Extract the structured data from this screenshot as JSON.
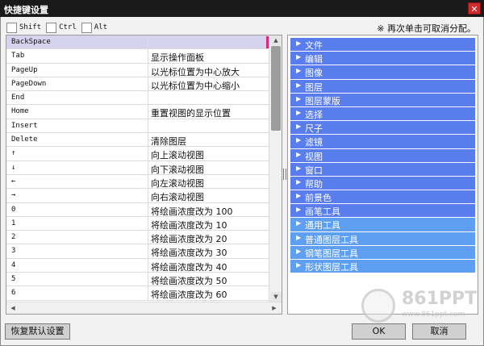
{
  "window": {
    "title": "快捷键设置",
    "close_glyph": "✕"
  },
  "modifiers": [
    {
      "label": "Shift",
      "checked": false
    },
    {
      "label": "Ctrl",
      "checked": false
    },
    {
      "label": "Alt",
      "checked": false
    }
  ],
  "hint": "※ 再次单击可取消分配。",
  "shortcuts": [
    {
      "key": "BackSpace",
      "action": "",
      "selected": true
    },
    {
      "key": "Tab",
      "action": "显示操作面板"
    },
    {
      "key": "PageUp",
      "action": "以光标位置为中心放大"
    },
    {
      "key": "PageDown",
      "action": "以光标位置为中心缩小"
    },
    {
      "key": "End",
      "action": ""
    },
    {
      "key": "Home",
      "action": "重置视图的显示位置"
    },
    {
      "key": "Insert",
      "action": ""
    },
    {
      "key": "Delete",
      "action": "清除图层"
    },
    {
      "key": "↑",
      "action": "向上滚动视图"
    },
    {
      "key": "↓",
      "action": "向下滚动视图"
    },
    {
      "key": "←",
      "action": "向左滚动视图"
    },
    {
      "key": "→",
      "action": "向右滚动视图"
    },
    {
      "key": "0",
      "action": "将绘画浓度改为 100"
    },
    {
      "key": "1",
      "action": "将绘画浓度改为 10"
    },
    {
      "key": "2",
      "action": "将绘画浓度改为 20"
    },
    {
      "key": "3",
      "action": "将绘画浓度改为 30"
    },
    {
      "key": "4",
      "action": "将绘画浓度改为 40"
    },
    {
      "key": "5",
      "action": "将绘画浓度改为 50"
    },
    {
      "key": "6",
      "action": "将绘画浓度改为 60"
    }
  ],
  "scroll_glyphs": {
    "up": "▲",
    "down": "▼",
    "left": "◀",
    "right": "▶"
  },
  "menu_arrow": "▶",
  "menu_groups": [
    {
      "label": "文件",
      "style": "dark"
    },
    {
      "label": "编辑",
      "style": "dark"
    },
    {
      "label": "图像",
      "style": "dark"
    },
    {
      "label": "图层",
      "style": "dark"
    },
    {
      "label": "图层蒙版",
      "style": "dark"
    },
    {
      "label": "选择",
      "style": "dark"
    },
    {
      "label": "尺子",
      "style": "dark"
    },
    {
      "label": "滤镜",
      "style": "dark"
    },
    {
      "label": "视图",
      "style": "dark"
    },
    {
      "label": "窗口",
      "style": "dark"
    },
    {
      "label": "帮助",
      "style": "dark"
    },
    {
      "label": "前景色",
      "style": "dark"
    },
    {
      "label": "画笔工具",
      "style": "dark"
    },
    {
      "label": "通用工具",
      "style": "light"
    },
    {
      "label": "普通图层工具",
      "style": "light"
    },
    {
      "label": "钢笔图层工具",
      "style": "light"
    },
    {
      "label": "形状图层工具",
      "style": "light"
    }
  ],
  "buttons": {
    "reset": "恢复默认设置",
    "ok": "OK",
    "cancel": "取消"
  },
  "watermark": {
    "brand": "861PPT",
    "sub": "www.861ppt.com"
  },
  "colors": {
    "menu_dark": "#5a7dee",
    "menu_light": "#5f9ff2",
    "selected_row": "#d6d3ee",
    "mark": "#e0267c",
    "titlebar": "#1a1a1a"
  }
}
